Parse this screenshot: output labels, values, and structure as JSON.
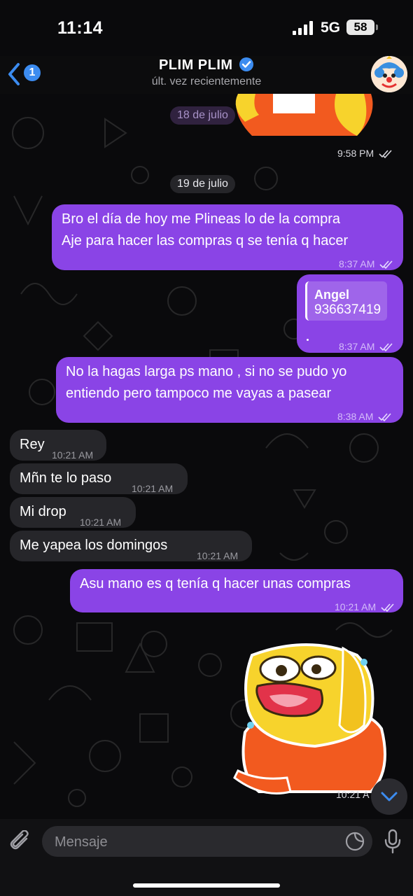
{
  "status_bar": {
    "time": "11:14",
    "network": "5G",
    "battery": "58"
  },
  "header": {
    "back_badge": "1",
    "title": "PLIM PLIM",
    "subtitle": "últ. vez recientemente"
  },
  "messages": [
    {
      "type": "sticker",
      "direction": "out",
      "time": "9:58 PM"
    },
    {
      "type": "date",
      "text": "18 de julio"
    },
    {
      "type": "date",
      "text": "19 de julio"
    },
    {
      "type": "text",
      "direction": "out",
      "lines": [
        "Bro el día de hoy me Plineas lo de la compra",
        "Aje para hacer las compras q se tenía q hacer"
      ],
      "time": "8:37 AM"
    },
    {
      "type": "contact",
      "direction": "out",
      "name": "Angel",
      "phone": "936637419",
      "time": "8:37 AM"
    },
    {
      "type": "text",
      "direction": "out",
      "lines": [
        "No la hagas larga ps mano , si no se pudo yo",
        "entiendo pero tampoco me vayas a pasear"
      ],
      "time": "8:38 AM"
    },
    {
      "type": "text",
      "direction": "in",
      "text": "Rey",
      "time": "10:21 AM"
    },
    {
      "type": "text",
      "direction": "in",
      "text": "Mñn te lo paso",
      "time": "10:21 AM"
    },
    {
      "type": "text",
      "direction": "in",
      "text": "Mi drop",
      "time": "10:21 AM"
    },
    {
      "type": "text",
      "direction": "in",
      "text": "Me yapea los domingos",
      "time": "10:21 AM"
    },
    {
      "type": "text",
      "direction": "out",
      "text": "Asu mano es q tenía q hacer unas compras",
      "time": "10:21 AM"
    },
    {
      "type": "sticker",
      "direction": "out",
      "time": "10:21 A"
    }
  ],
  "input": {
    "placeholder": "Mensaje"
  },
  "colors": {
    "outgoing": "#8a44e6",
    "incoming": "#26262a",
    "accent": "#3c8cf0"
  },
  "icons": [
    "back-chevron-icon",
    "verified-icon",
    "double-check-icon",
    "attach-icon",
    "sticker-icon",
    "mic-icon",
    "chevron-down-icon"
  ]
}
